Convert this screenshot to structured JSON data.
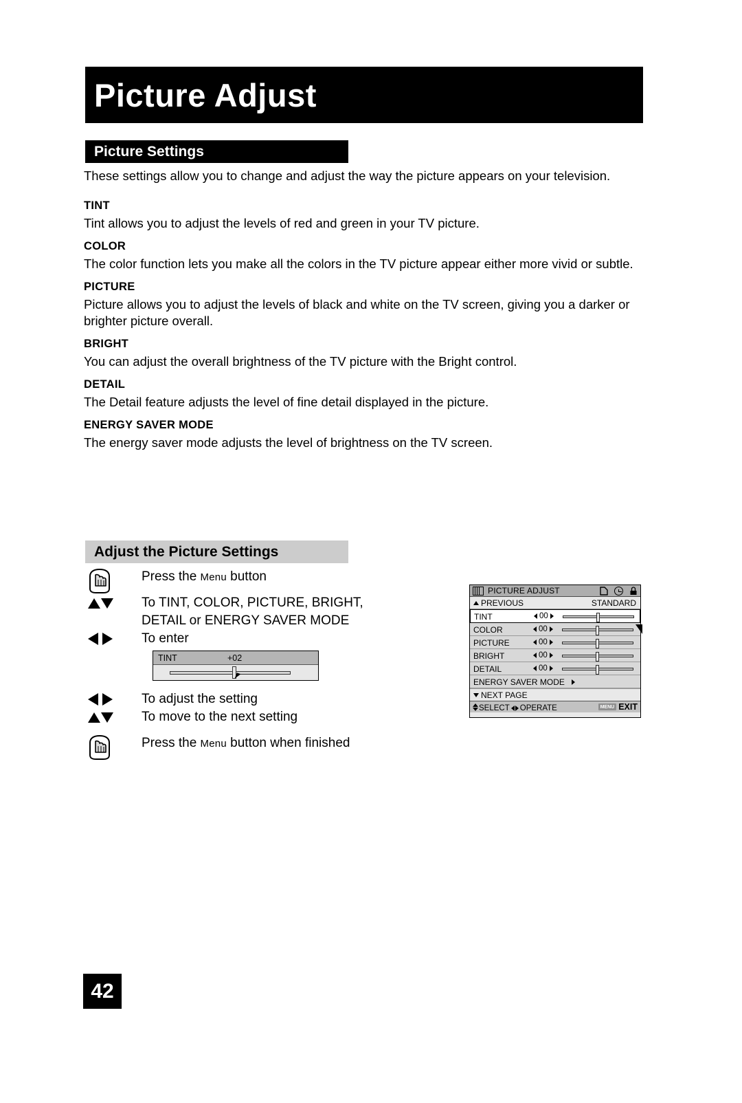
{
  "header": {
    "title": "Picture Adjust"
  },
  "picture_settings": {
    "heading": "Picture Settings",
    "intro": "These settings allow you to change and adjust the way the picture appears on your television.",
    "definitions": [
      {
        "term": "TINT",
        "description": "Tint allows you to adjust the levels of red and green in your TV picture."
      },
      {
        "term": "COLOR",
        "description": "The color function lets you make all the colors in the TV picture appear either more vivid or subtle."
      },
      {
        "term": "PICTURE",
        "description": "Picture allows you to adjust the levels of black and white on the TV screen, giving you a darker or brighter picture overall."
      },
      {
        "term": "BRIGHT",
        "description": "You can adjust the overall brightness of the TV picture with the Bright control."
      },
      {
        "term": "DETAIL",
        "description": "The Detail feature adjusts the level of fine detail displayed in the picture."
      },
      {
        "term": "ENERGY SAVER MODE",
        "description": "The energy saver mode adjusts the level of brightness on the TV screen."
      }
    ]
  },
  "adjust_section": {
    "heading": "Adjust the Picture Settings",
    "steps": [
      {
        "icon": "menu-button-icon",
        "text_before": "Press the ",
        "smallcap": "Menu",
        "text_after": " button"
      },
      {
        "icon": "up-down-arrows-icon",
        "line1": "To TINT, COLOR, PICTURE, BRIGHT,",
        "line2": "DETAIL or ENERGY SAVER MODE"
      },
      {
        "icon": "left-right-arrows-icon",
        "text": "To enter"
      },
      {
        "icon": "left-right-arrows-icon",
        "text": "To adjust the setting"
      },
      {
        "icon": "up-down-arrows-icon",
        "text": "To move to the next setting"
      },
      {
        "icon": "menu-button-icon",
        "text_before": "Press the ",
        "smallcap": "Menu",
        "text_after": " button when finished"
      }
    ]
  },
  "tint_inset": {
    "label": "TINT",
    "value": "+02"
  },
  "osd": {
    "title": "PICTURE ADJUST",
    "app_icon": "picture-adjust-icon",
    "header_icons": [
      "page-icon",
      "clock-icon",
      "lock-icon"
    ],
    "previous_label": "PREVIOUS",
    "mode_label": "STANDARD",
    "rows": [
      {
        "label": "TINT",
        "value": "00",
        "selected": true
      },
      {
        "label": "COLOR",
        "value": "00",
        "selected": false
      },
      {
        "label": "PICTURE",
        "value": "00",
        "selected": false
      },
      {
        "label": "BRIGHT",
        "value": "00",
        "selected": false
      },
      {
        "label": "DETAIL",
        "value": "00",
        "selected": false
      }
    ],
    "submenu_row": {
      "label": "ENERGY SAVER MODE"
    },
    "next_page_label": "NEXT PAGE",
    "footer": {
      "select_label": "SELECT",
      "operate_label": "OPERATE",
      "menu_chip": "MENU",
      "exit_label": "EXIT"
    }
  },
  "footer": {
    "page_number": "42"
  }
}
